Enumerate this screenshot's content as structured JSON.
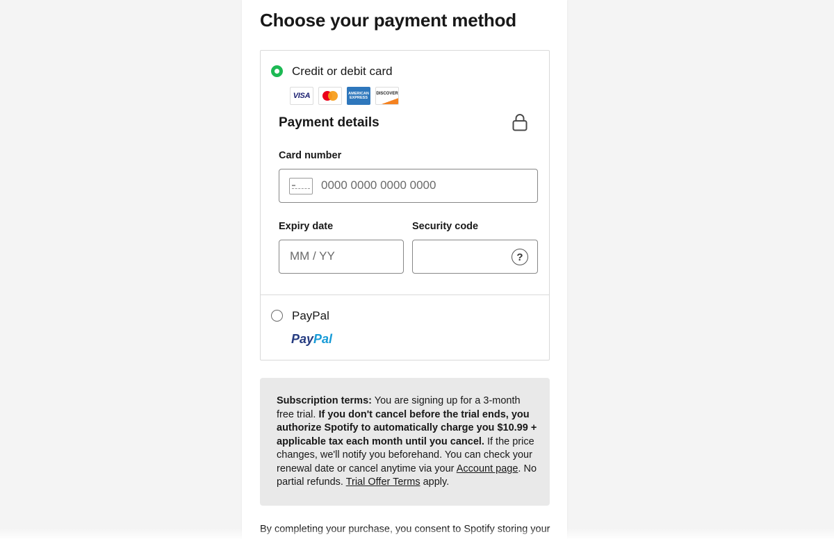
{
  "page": {
    "title": "Choose your payment method"
  },
  "methods": {
    "card": {
      "label": "Credit or debit card",
      "selected": true,
      "logos": [
        {
          "name": "visa",
          "text": "VISA"
        },
        {
          "name": "mastercard",
          "text": ""
        },
        {
          "name": "amex",
          "text": "AMERICAN EXPRESS"
        },
        {
          "name": "discover",
          "text": "DISCOVER"
        }
      ],
      "details_heading": "Payment details",
      "card_number": {
        "label": "Card number",
        "placeholder": "0000 0000 0000 0000",
        "value": ""
      },
      "expiry": {
        "label": "Expiry date",
        "placeholder": "MM / YY",
        "value": ""
      },
      "security": {
        "label": "Security code",
        "placeholder": "",
        "value": "",
        "help": "?"
      }
    },
    "paypal": {
      "label": "PayPal",
      "selected": false,
      "logo_part1": "Pay",
      "logo_part2": "Pal"
    }
  },
  "terms": {
    "heading": "Subscription terms:",
    "intro": " You are signing up for a 3-month free trial. ",
    "bold": "If you don't cancel before the trial ends, you authorize Spotify to automatically charge you $10.99 + applicable tax each month until you cancel.",
    "middle": " If the price changes, we'll notify you beforehand. You can check your renewal date or cancel anytime via your ",
    "account_link": "Account page",
    "after_link": ". No partial refunds. ",
    "trial_link": "Trial Offer Terms",
    "end": " apply."
  },
  "consent": {
    "text": "By completing your purchase, you consent to Spotify storing your"
  },
  "colors": {
    "accent": "#1db954",
    "terms_bg": "#e9e9e9",
    "paypal_dark": "#253b80",
    "paypal_light": "#179bd7"
  }
}
